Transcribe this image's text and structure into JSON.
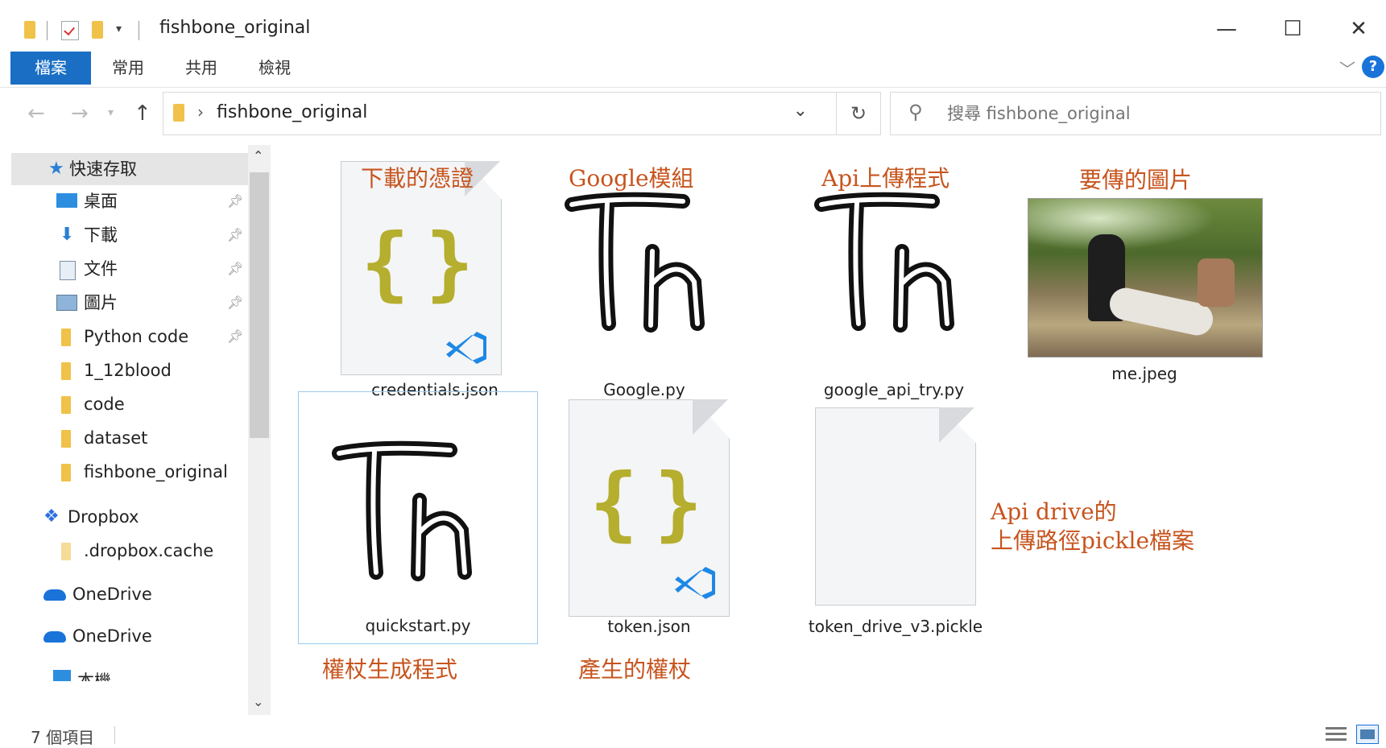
{
  "window": {
    "title": "fishbone_original",
    "controls": {
      "minimize": "—",
      "maximize": "☐",
      "close": "✕"
    }
  },
  "ribbon": {
    "tabs": [
      "檔案",
      "常用",
      "共用",
      "檢視"
    ],
    "help": "?"
  },
  "address": {
    "path": "fishbone_original",
    "search_placeholder": "搜尋 fishbone_original"
  },
  "sidebar": {
    "quick_access": "快速存取",
    "items": [
      {
        "label": "桌面",
        "pinned": true,
        "icon": "desktop-icon"
      },
      {
        "label": "下載",
        "pinned": true,
        "icon": "download-icon"
      },
      {
        "label": "文件",
        "pinned": true,
        "icon": "document-icon"
      },
      {
        "label": "圖片",
        "pinned": true,
        "icon": "pictures-icon"
      },
      {
        "label": "Python code",
        "pinned": true,
        "icon": "folder-icon"
      },
      {
        "label": "1_12blood",
        "pinned": false,
        "icon": "folder-icon"
      },
      {
        "label": "code",
        "pinned": false,
        "icon": "folder-icon"
      },
      {
        "label": "dataset",
        "pinned": false,
        "icon": "folder-icon"
      },
      {
        "label": "fishbone_original",
        "pinned": false,
        "icon": "folder-icon"
      }
    ],
    "dropbox": "Dropbox",
    "dropbox_cache": ".dropbox.cache",
    "onedrive1": "OneDrive",
    "onedrive2": "OneDrive",
    "partial": "本機"
  },
  "files": [
    {
      "name": "credentials.json",
      "type": "json"
    },
    {
      "name": "Google.py",
      "type": "py"
    },
    {
      "name": "google_api_try.py",
      "type": "py"
    },
    {
      "name": "me.jpeg",
      "type": "image"
    },
    {
      "name": "quickstart.py",
      "type": "py"
    },
    {
      "name": "token.json",
      "type": "json"
    },
    {
      "name": "token_drive_v3.pickle",
      "type": "pickle"
    }
  ],
  "annotations": {
    "credentials": "下載的憑證",
    "google": "Google模組",
    "api_upload": "Api上傳程式",
    "image": "要傳的圖片",
    "pickle_line1": "Api drive的",
    "pickle_line2": "上傳路徑pickle檔案",
    "quickstart": "權杖生成程式",
    "token": "產生的權杖"
  },
  "status": {
    "count": "7 個項目"
  },
  "colors": {
    "accent": "#1a6fc4",
    "annotation": "#c7541d",
    "braces": "#b5ae2e",
    "vscode": "#1e88e5"
  }
}
